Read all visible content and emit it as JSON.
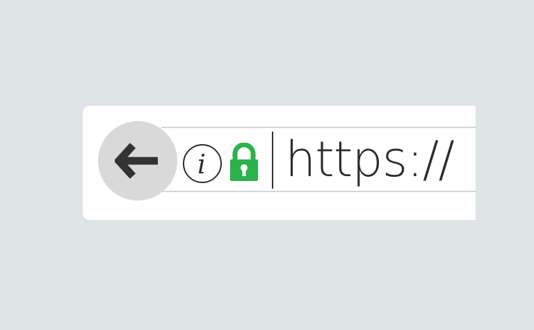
{
  "browser": {
    "back_button": {
      "icon": "arrow-left-icon",
      "color": "#333333",
      "background": "#d9d9d9"
    },
    "site_info": {
      "icon": "info-icon",
      "glyph": "i"
    },
    "security": {
      "icon": "padlock-icon",
      "state": "secure",
      "color": "#2bb24c"
    },
    "address_bar": {
      "url": "https://"
    }
  }
}
